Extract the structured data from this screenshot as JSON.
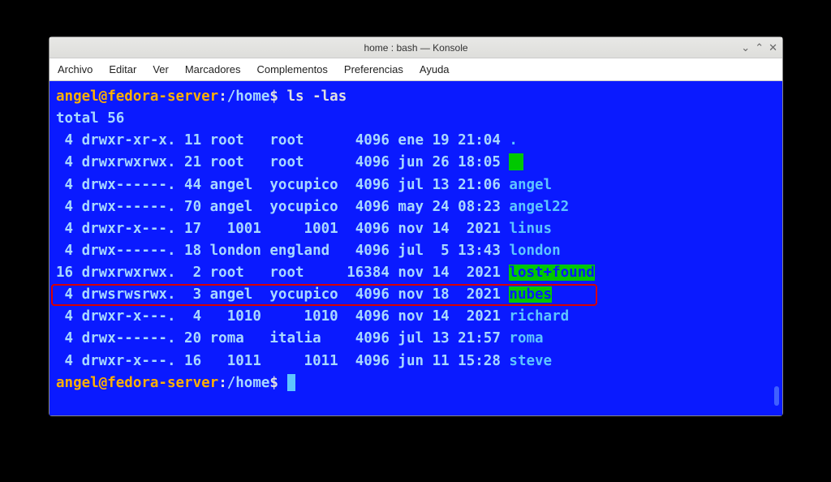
{
  "window": {
    "title": "home : bash — Konsole"
  },
  "menubar": [
    "Archivo",
    "Editar",
    "Ver",
    "Marcadores",
    "Complementos",
    "Preferencias",
    "Ayuda"
  ],
  "prompt": {
    "user": "angel@fedora-server",
    "path": "/home",
    "symbol": "$"
  },
  "command": "ls -las",
  "total_line": "total 56",
  "listing": [
    {
      "blocks": " 4",
      "perm": "drwxr-xr-x.",
      "links": "11",
      "owner": "root  ",
      "group": "root    ",
      "size": " 4096",
      "date": "ene 19 21:04",
      "name": ".",
      "style": "dir"
    },
    {
      "blocks": " 4",
      "perm": "drwxrwxrwx.",
      "links": "21",
      "owner": "root  ",
      "group": "root    ",
      "size": " 4096",
      "date": "jun 26 18:05",
      "name": "",
      "style": "greenblock"
    },
    {
      "blocks": " 4",
      "perm": "drwx------.",
      "links": "44",
      "owner": "angel ",
      "group": "yocupico",
      "size": " 4096",
      "date": "jul 13 21:06",
      "name": "angel",
      "style": "dir"
    },
    {
      "blocks": " 4",
      "perm": "drwx------.",
      "links": "70",
      "owner": "angel ",
      "group": "yocupico",
      "size": " 4096",
      "date": "may 24 08:23",
      "name": "angel22",
      "style": "dir"
    },
    {
      "blocks": " 4",
      "perm": "drwxr-x---.",
      "links": "17",
      "owner": "  1001",
      "group": "    1001",
      "size": " 4096",
      "date": "nov 14  2021",
      "name": "linus",
      "style": "dir"
    },
    {
      "blocks": " 4",
      "perm": "drwx------.",
      "links": "18",
      "owner": "london",
      "group": "england ",
      "size": " 4096",
      "date": "jul  5 13:43",
      "name": "london",
      "style": "dir"
    },
    {
      "blocks": "16",
      "perm": "drwxrwxrwx.",
      "links": " 2",
      "owner": "root  ",
      "group": "root    ",
      "size": "16384",
      "date": "nov 14  2021",
      "name": "lost+found",
      "style": "sticky"
    },
    {
      "blocks": " 4",
      "perm": "drwsrwsrwx.",
      "links": " 3",
      "owner": "angel ",
      "group": "yocupico",
      "size": " 4096",
      "date": "nov 18  2021",
      "name": "nubes",
      "style": "sticky",
      "highlight": true
    },
    {
      "blocks": " 4",
      "perm": "drwxr-x---.",
      "links": " 4",
      "owner": "  1010",
      "group": "    1010",
      "size": " 4096",
      "date": "nov 14  2021",
      "name": "richard",
      "style": "dir"
    },
    {
      "blocks": " 4",
      "perm": "drwx------.",
      "links": "20",
      "owner": "roma  ",
      "group": "italia  ",
      "size": " 4096",
      "date": "jul 13 21:57",
      "name": "roma",
      "style": "dir"
    },
    {
      "blocks": " 4",
      "perm": "drwxr-x---.",
      "links": "16",
      "owner": "  1011",
      "group": "    1011",
      "size": " 4096",
      "date": "jun 11 15:28",
      "name": "steve",
      "style": "dir"
    }
  ]
}
